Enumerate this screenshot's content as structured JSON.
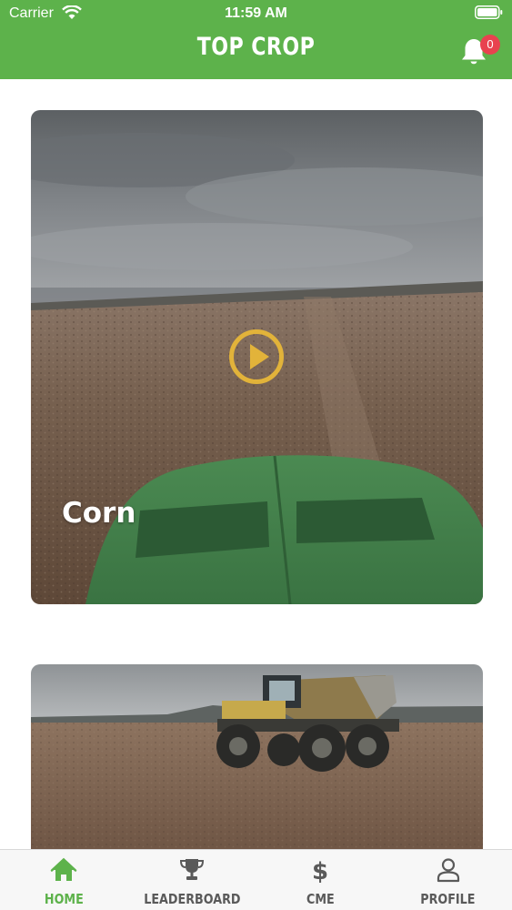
{
  "status_bar": {
    "carrier": "Carrier",
    "time": "11:59 AM"
  },
  "app_bar": {
    "title": "TOP CROP",
    "notification_count": "0",
    "icon": "bell-icon"
  },
  "feed": {
    "cards": [
      {
        "label": "Corn",
        "has_play_button": true
      },
      {
        "label": ""
      }
    ]
  },
  "tab_bar": {
    "tabs": [
      {
        "label": "HOME",
        "icon": "home-icon",
        "active": true
      },
      {
        "label": "LEADERBOARD",
        "icon": "trophy-icon",
        "active": false
      },
      {
        "label": "CME",
        "icon": "dollar-icon",
        "active": false
      },
      {
        "label": "PROFILE",
        "icon": "person-icon",
        "active": false
      }
    ]
  },
  "colors": {
    "brand_green": "#5db24b",
    "badge_red": "#e8424f",
    "play_yellow": "#e2b33a",
    "tab_inactive": "#5a5a5a"
  }
}
